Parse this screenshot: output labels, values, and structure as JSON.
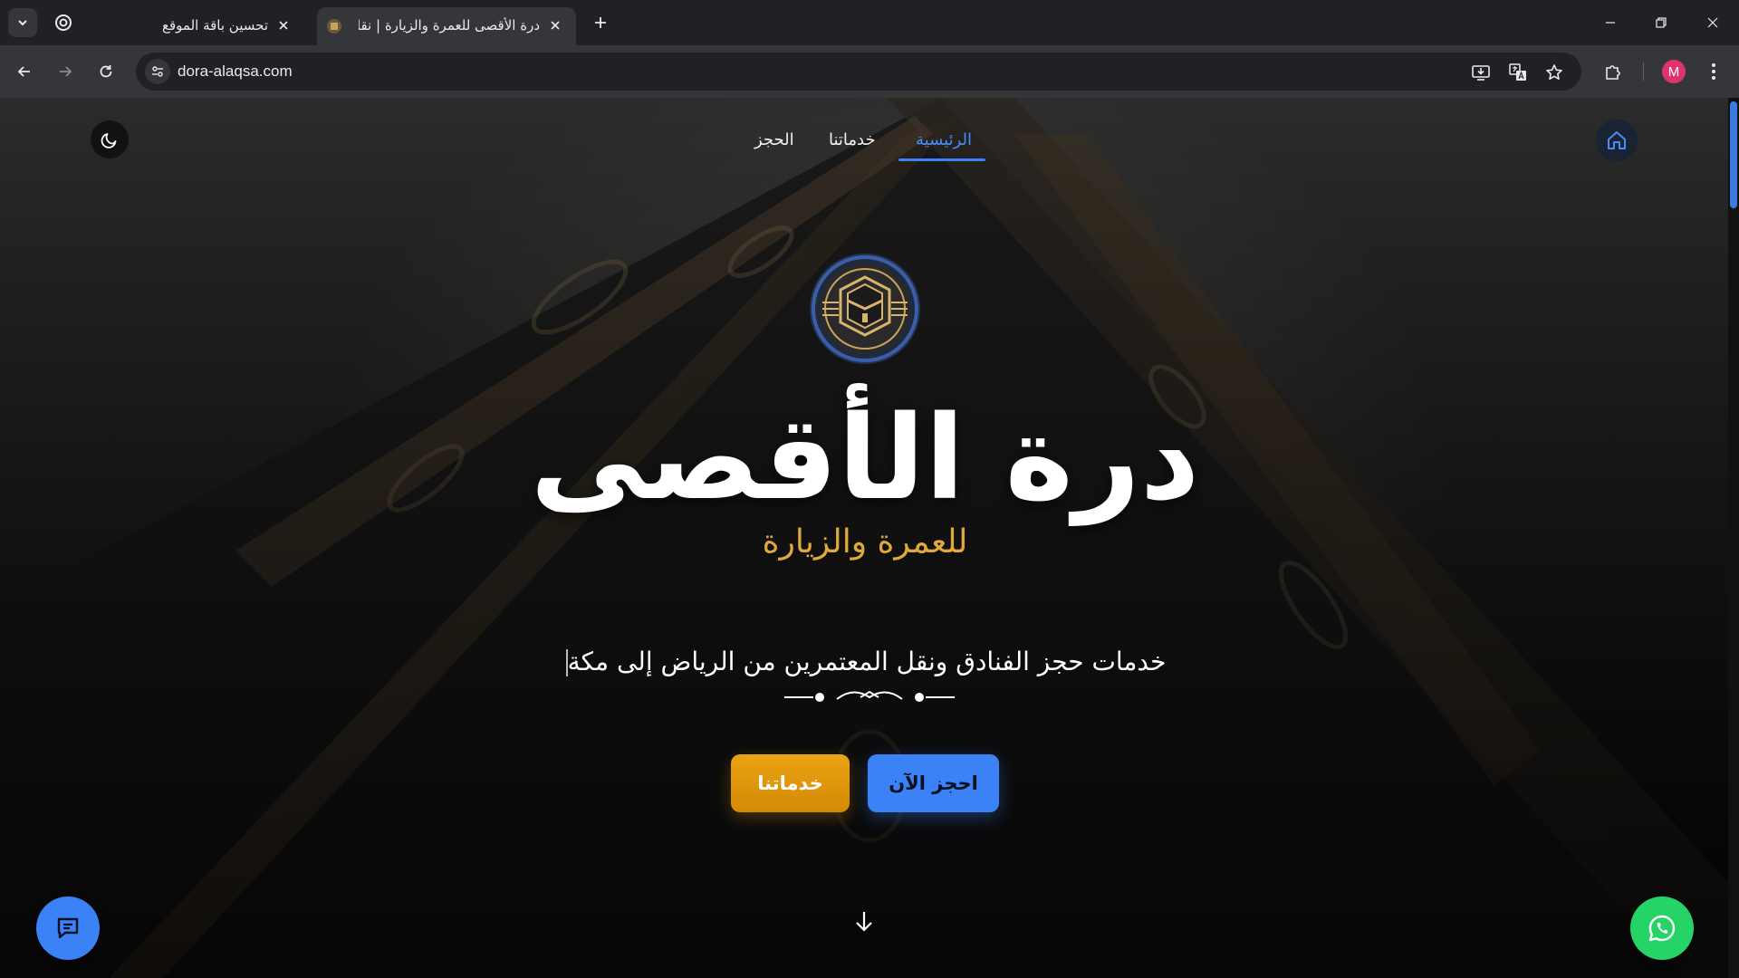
{
  "browser": {
    "tabs": [
      {
        "title": "تحسين باقة الموقع",
        "active": false
      },
      {
        "title": "درة الأقصى للعمرة والزيارة | نقل ا",
        "active": true
      }
    ],
    "url": "dora-alaqsa.com",
    "profile_initial": "M",
    "icons": {
      "tab_list": "chevron-down-icon",
      "tab_search": "openai-logo-icon",
      "new_tab": "plus-icon",
      "minimize": "minimize-icon",
      "restore": "restore-icon",
      "close": "close-icon",
      "back": "arrow-left-icon",
      "forward": "arrow-right-icon",
      "reload": "reload-icon",
      "install": "install-app-icon",
      "translate": "translate-icon",
      "bookmark": "star-icon",
      "extensions": "puzzle-icon",
      "menu": "kebab-menu-icon"
    }
  },
  "nav": {
    "links": [
      {
        "label": "الرئيسية",
        "active": true
      },
      {
        "label": "خدماتنا",
        "active": false
      },
      {
        "label": "الحجز",
        "active": false
      }
    ],
    "accent_color": "#3b82f6"
  },
  "hero": {
    "title": "درة الأقصى",
    "subtitle": "للعمرة والزيارة",
    "description": "خدمات حجز الفنادق ونقل المعتمرين من الرياض إلى مكة",
    "buttons": {
      "book": "احجز الآن",
      "services": "خدماتنا"
    },
    "subtitle_color": "#e0a93a",
    "services_color": "#e69c10"
  },
  "fab": {
    "chat_icon": "chat-bubble-icon",
    "whatsapp_icon": "whatsapp-icon",
    "whatsapp_color": "#25d366"
  }
}
